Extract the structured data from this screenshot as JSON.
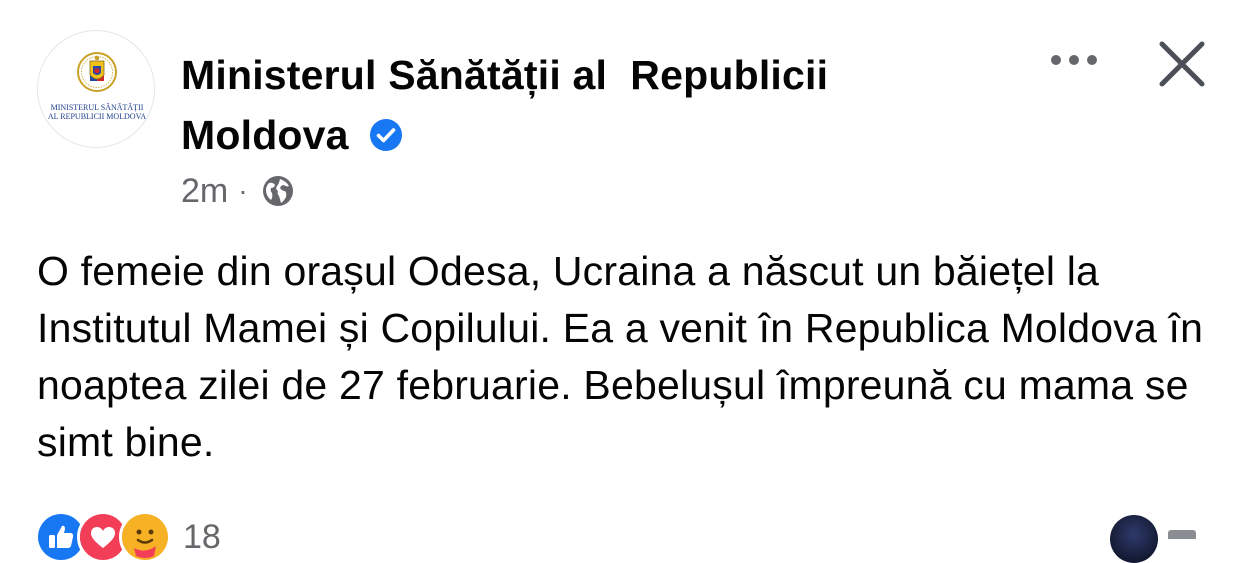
{
  "post": {
    "page_name": "Ministerul Sănătății al  Republicii Moldova",
    "avatar_caption_line1": "MINISTERUL SĂNĂTĂȚII",
    "avatar_caption_line2": "AL REPUBLICII MOLDOVA",
    "timestamp": "2m",
    "separator": "·",
    "audience_icon": "globe-icon",
    "verified_icon": "verified-badge-icon",
    "text": "O femeie din orașul Odesa, Ucraina a născut un băiețel la Institutul Mamei și Copilului. Ea a venit în Republica Moldova în noaptea zilei de 27 februarie. Bebelușul împreună cu mama se simt bine."
  },
  "header_actions": {
    "more_icon": "more-horizontal-icon",
    "close_icon": "close-icon"
  },
  "reactions": {
    "icons": [
      "like-icon",
      "love-icon",
      "care-icon"
    ],
    "count": "18"
  },
  "colors": {
    "verified_blue": "#1877f2",
    "like_blue": "#1877f2",
    "love_red": "#f33e58",
    "care_yellow": "#f7b125",
    "meta_gray": "#65676b"
  }
}
